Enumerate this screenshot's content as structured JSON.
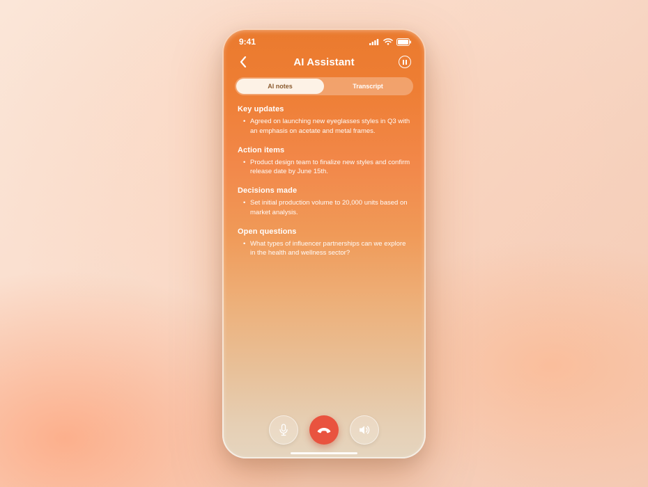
{
  "statusbar": {
    "time": "9:41"
  },
  "header": {
    "title": "AI Assistant"
  },
  "tabs": {
    "active": "AI notes",
    "inactive": "Transcript"
  },
  "sections": {
    "keyUpdates": {
      "title": "Key updates",
      "item": "Agreed on launching new eyeglasses styles in Q3 with an emphasis on acetate and metal frames."
    },
    "actionItems": {
      "title": "Action items",
      "item": "Product design team to finalize new styles and confirm release date by June 15th."
    },
    "decisionsMade": {
      "title": "Decisions made",
      "item": "Set initial production volume to 20,000 units based on market analysis."
    },
    "openQuestions": {
      "title": "Open questions",
      "item": "What types of influencer partnerships can we explore in the health and wellness sector?"
    }
  }
}
